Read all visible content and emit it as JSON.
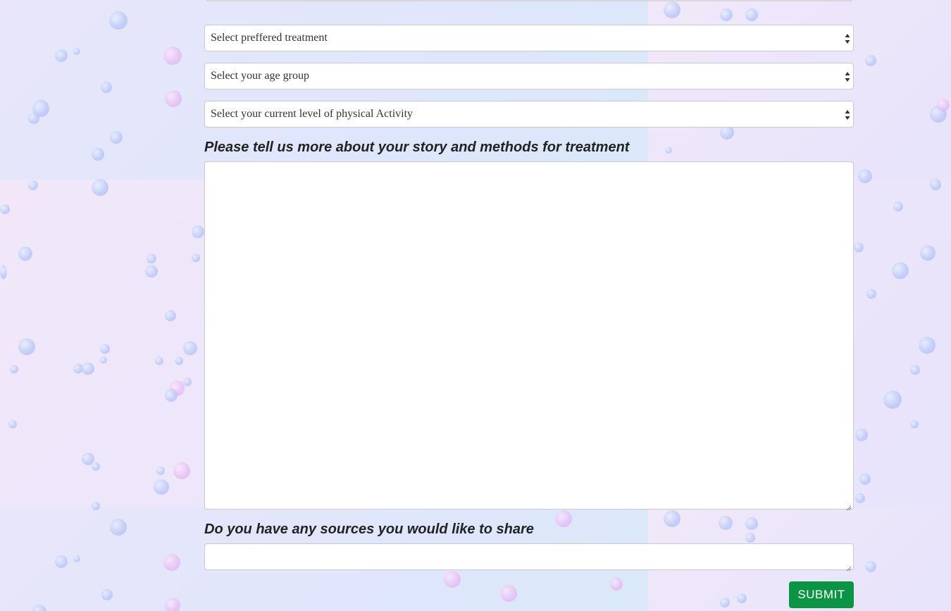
{
  "form": {
    "selects": [
      {
        "name": "treatment-select",
        "value": "Select preffered treatment"
      },
      {
        "name": "age-group-select",
        "value": "Select your age group"
      },
      {
        "name": "activity-level-select",
        "value": "Select your current level of physical Activity"
      }
    ],
    "story_label": "Please tell us more about your story and methods for treatment",
    "story_value": "",
    "sources_label": "Do you have any sources you would like to share",
    "sources_value": "",
    "submit_label": "SUBMIT"
  },
  "colors": {
    "submit": "#0b9444",
    "background": "#ece6f8"
  }
}
